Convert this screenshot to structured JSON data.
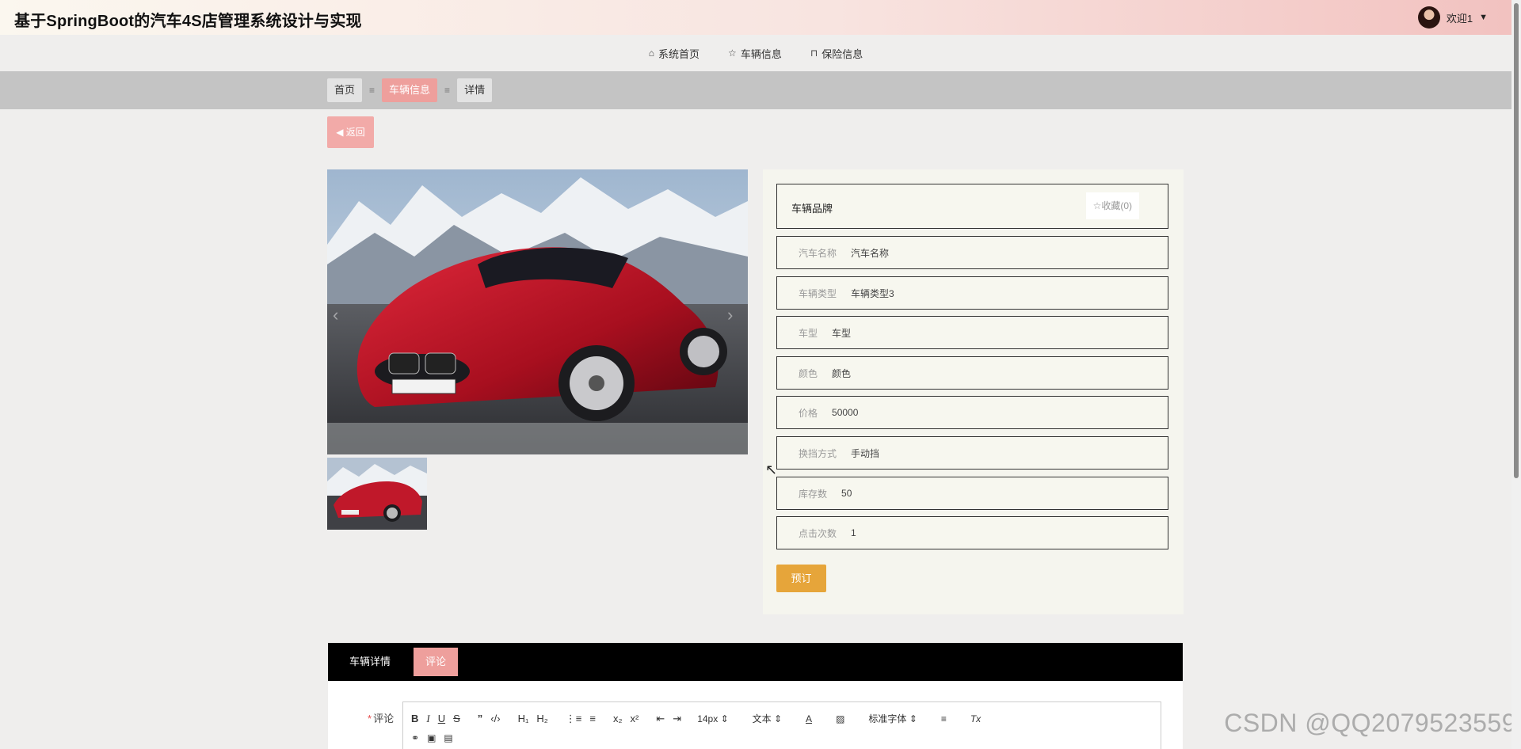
{
  "header": {
    "site_title": "基于SpringBoot的汽车4S店管理系统设计与实现",
    "user_greeting": "欢迎1"
  },
  "nav": {
    "items": [
      {
        "label": "系统首页",
        "icon": "home-icon"
      },
      {
        "label": "车辆信息",
        "icon": "star-icon"
      },
      {
        "label": "保险信息",
        "icon": "bag-icon"
      }
    ]
  },
  "breadcrumb": {
    "items": [
      "首页",
      "车辆信息",
      "详情"
    ],
    "separator": "≡",
    "active_index": 1
  },
  "back_button": {
    "label": "返回"
  },
  "detail": {
    "brand_label": "车辆品牌",
    "favorite_label": "☆收藏(0)",
    "fields": [
      {
        "label": "汽车名称",
        "value": "汽车名称"
      },
      {
        "label": "车辆类型",
        "value": "车辆类型3"
      },
      {
        "label": "车型",
        "value": "车型"
      },
      {
        "label": "颜色",
        "value": "颜色"
      },
      {
        "label": "价格",
        "value": "50000"
      },
      {
        "label": "换挡方式",
        "value": "手动挡"
      },
      {
        "label": "库存数",
        "value": "50"
      },
      {
        "label": "点击次数",
        "value": "1"
      }
    ],
    "book_button": "预订"
  },
  "tabs": {
    "items": [
      "车辆详情",
      "评论"
    ],
    "active_index": 1
  },
  "comment": {
    "label": "评论",
    "required_mark": "*",
    "toolbar": {
      "font_size": "14px",
      "text_style": "文本",
      "font_family": "标准字体"
    }
  },
  "watermark": "CSDN @QQ2079523559",
  "colors": {
    "accent_pink": "#ee9f9c",
    "book_orange": "#e6a53a",
    "tab_bar": "#000000"
  }
}
